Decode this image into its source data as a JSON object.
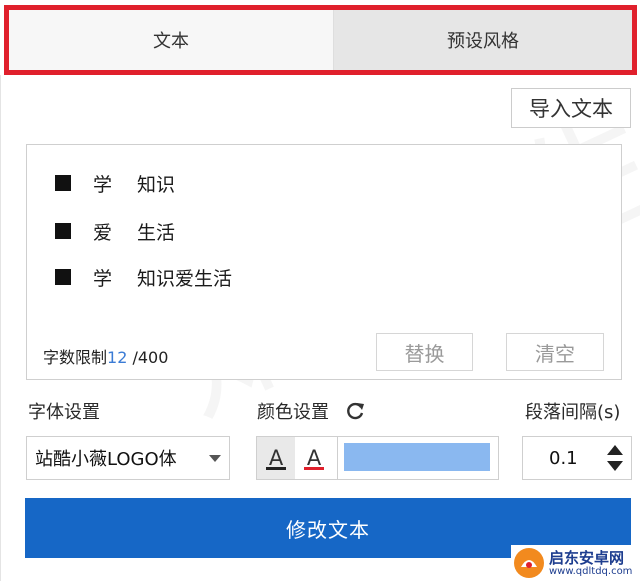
{
  "tabs": [
    {
      "label": "文本",
      "active": true
    },
    {
      "label": "预设风格",
      "active": false
    }
  ],
  "import_button": "导入文本",
  "text_lines": [
    {
      "a": "学",
      "b": "知识"
    },
    {
      "a": "爱",
      "b": "生活"
    },
    {
      "a": "学",
      "b": "知识爱生活"
    }
  ],
  "char_limit": {
    "label": "字数限制",
    "count": "12",
    "max": " /400"
  },
  "actions": {
    "replace": "替换",
    "clear": "清空"
  },
  "font_setting": {
    "label": "字体设置",
    "value": "站酷小薇LOGO体"
  },
  "color_setting": {
    "label": "颜色设置",
    "a_glyph": "A",
    "swatch_color": "#8ab8f0",
    "underline_colors": [
      "#222222",
      "#e0202c"
    ]
  },
  "paragraph_spacing": {
    "label": "段落间隔(s)",
    "value": "0.1"
  },
  "submit_button": "修改文本",
  "watermark": {
    "bg_text": "知识爱生",
    "site_name": "启东安卓网",
    "site_url": "www.qdltdq.com"
  },
  "colors": {
    "accent": "#1667c6",
    "highlight_border": "#e0202c"
  }
}
